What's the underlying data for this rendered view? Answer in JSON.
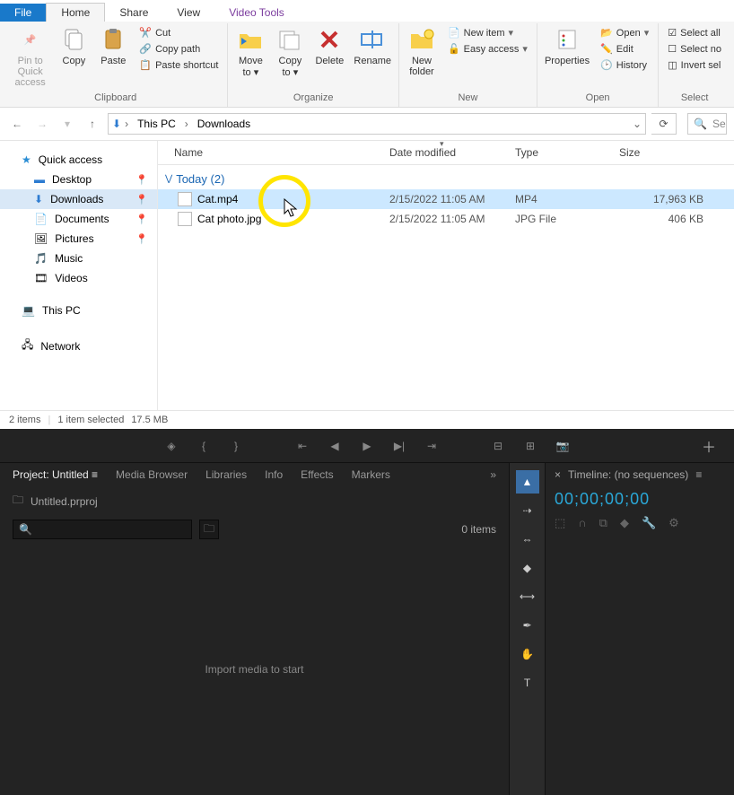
{
  "tabs": {
    "file": "File",
    "home": "Home",
    "share": "Share",
    "view": "View",
    "video": "Video Tools"
  },
  "ribbon": {
    "clipboard": {
      "pin": "Pin to Quick\naccess",
      "copy": "Copy",
      "paste": "Paste",
      "cut": "Cut",
      "copypath": "Copy path",
      "pasteshortcut": "Paste shortcut",
      "label": "Clipboard"
    },
    "organize": {
      "moveto": "Move\nto ▾",
      "copyto": "Copy\nto ▾",
      "delete": "Delete",
      "rename": "Rename",
      "label": "Organize"
    },
    "new_grp": {
      "newfolder": "New\nfolder",
      "newitem": "New item",
      "easyaccess": "Easy access",
      "label": "New"
    },
    "open_grp": {
      "properties": "Properties",
      "open": "Open",
      "edit": "Edit",
      "history": "History",
      "label": "Open"
    },
    "select_grp": {
      "selectall": "Select all",
      "selectnone": "Select no",
      "invert": "Invert sel",
      "label": "Select"
    }
  },
  "breadcrumb": {
    "thispc": "This PC",
    "downloads": "Downloads"
  },
  "search_placeholder": "Se",
  "sidebar": {
    "quick": "Quick access",
    "items": [
      "Desktop",
      "Downloads",
      "Documents",
      "Pictures",
      "Music",
      "Videos"
    ],
    "thispc": "This PC",
    "network": "Network"
  },
  "columns": {
    "name": "Name",
    "date": "Date modified",
    "type": "Type",
    "size": "Size"
  },
  "group": "Today (2)",
  "files": [
    {
      "name": "Cat.mp4",
      "date": "2/15/2022 11:05 AM",
      "type": "MP4",
      "size": "17,963 KB",
      "selected": true
    },
    {
      "name": "Cat photo.jpg",
      "date": "2/15/2022 11:05 AM",
      "type": "JPG File",
      "size": "406 KB",
      "selected": false
    }
  ],
  "status": {
    "count": "2 items",
    "sel": "1 item selected",
    "size": "17.5 MB"
  },
  "premiere": {
    "tabs": {
      "project": "Project: Untitled",
      "media": "Media Browser",
      "libraries": "Libraries",
      "info": "Info",
      "effects": "Effects",
      "markers": "Markers"
    },
    "projfile": "Untitled.prproj",
    "items": "0 items",
    "drop": "Import media to start",
    "timeline": "Timeline: (no sequences)",
    "timecode": "00;00;00;00"
  }
}
